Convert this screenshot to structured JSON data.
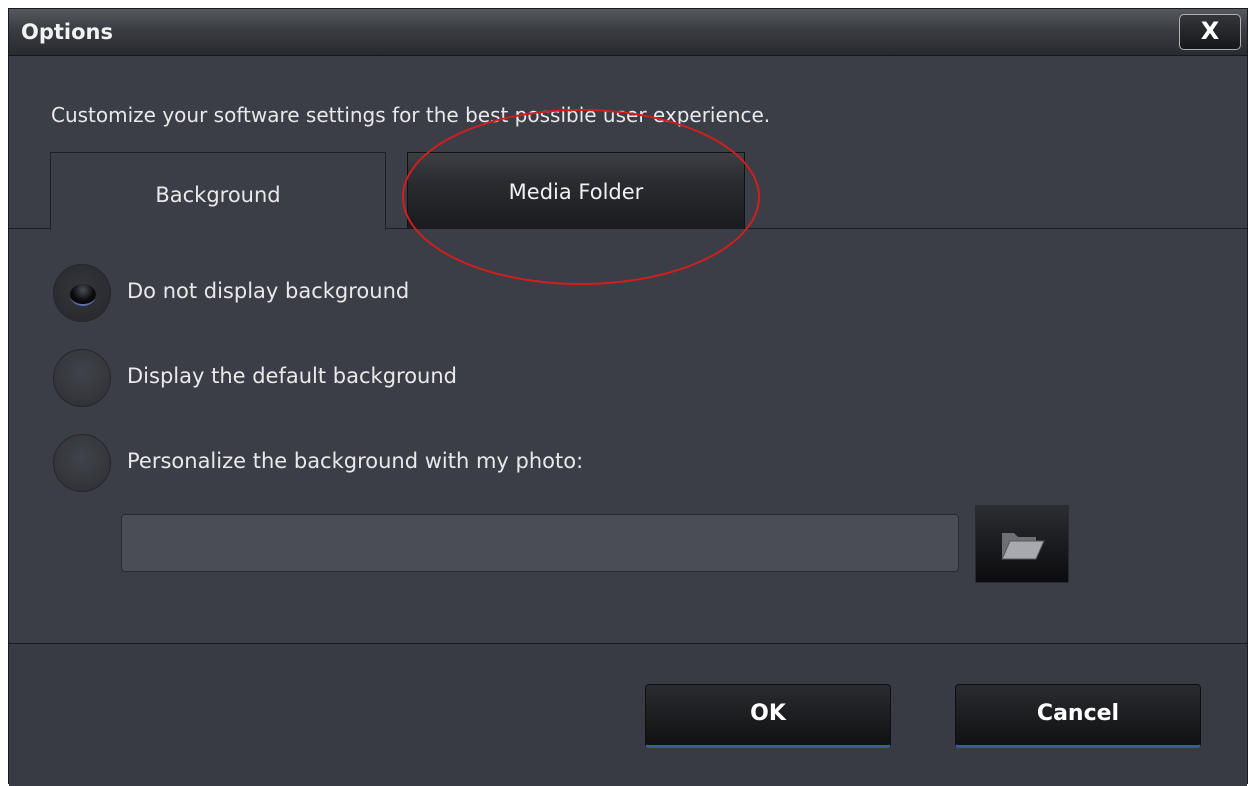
{
  "window": {
    "title": "Options",
    "close_label": "X"
  },
  "description": "Customize your software settings for the best possible user experience.",
  "tabs": [
    {
      "label": "Background",
      "selected": true
    },
    {
      "label": "Media Folder",
      "selected": false
    }
  ],
  "annotation": {
    "color": "#d41d1d",
    "shape": "ellipse around Media Folder tab"
  },
  "background_options": [
    {
      "label": "Do not display background",
      "checked": true
    },
    {
      "label": "Display the default background",
      "checked": false
    },
    {
      "label": "Personalize the background with my photo:",
      "checked": false
    }
  ],
  "photo_path": {
    "value": "",
    "placeholder": ""
  },
  "browse": {
    "icon": "folder-open-icon"
  },
  "footer": {
    "ok_label": "OK",
    "cancel_label": "Cancel"
  },
  "colors": {
    "window_bg": "#3b3e46",
    "titlebar_bg": "#3a3c42",
    "button_accent": "#3a5a9a",
    "text": "#e9e9ea"
  }
}
